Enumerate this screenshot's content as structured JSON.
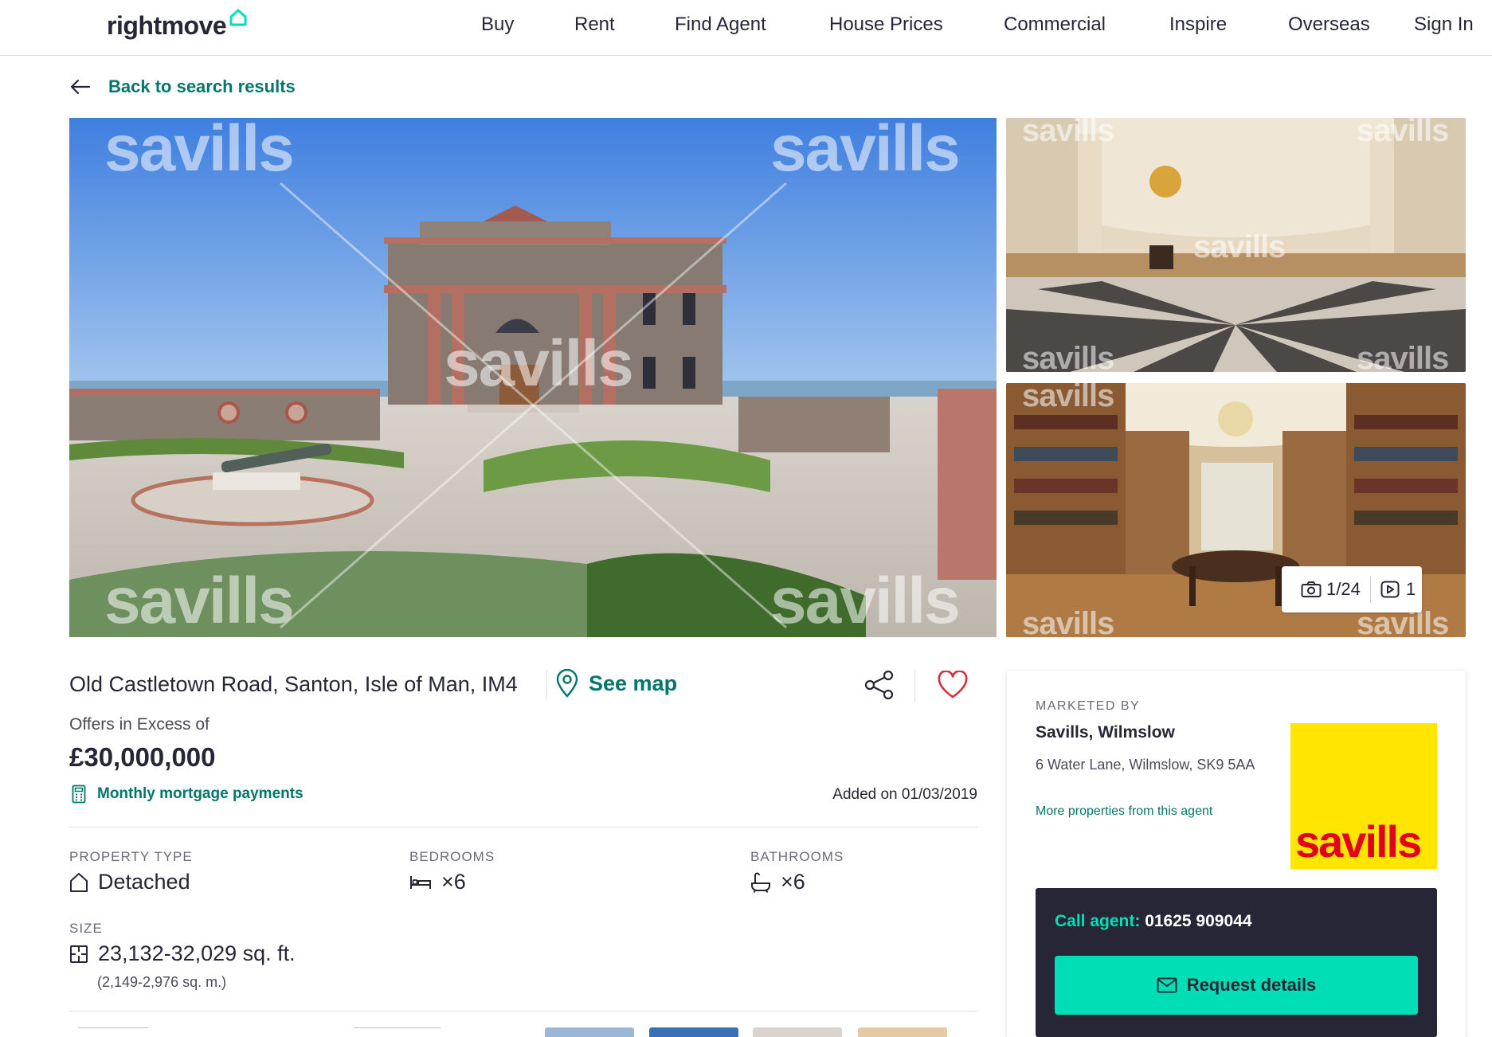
{
  "header": {
    "logo": "rightmove",
    "nav": [
      "Buy",
      "Rent",
      "Find Agent",
      "House Prices",
      "Commercial",
      "Inspire",
      "Overseas"
    ],
    "sign_in": "Sign In"
  },
  "back_link": "Back to search results",
  "gallery": {
    "watermark": "savills",
    "photo_counter": "1/24",
    "video_counter": "1"
  },
  "listing": {
    "address": "Old Castletown Road, Santon, Isle of Man, IM4",
    "see_map": "See map",
    "price_qualifier": "Offers in Excess of",
    "price": "£30,000,000",
    "mortgage_link": "Monthly mortgage payments",
    "added": "Added on 01/03/2019"
  },
  "key_features": {
    "property_type_label": "PROPERTY TYPE",
    "property_type": "Detached",
    "bedrooms_label": "BEDROOMS",
    "bedrooms": "×6",
    "bathrooms_label": "BATHROOMS",
    "bathrooms": "×6",
    "size_label": "SIZE",
    "size": "23,132-32,029 sq. ft.",
    "size_metric": "(2,149-2,976 sq. m.)"
  },
  "agent": {
    "marketed_by": "MARKETED BY",
    "name": "Savills, Wilmslow",
    "address": "6 Water Lane, Wilmslow, SK9 5AA",
    "more_link": "More properties from this agent",
    "logo_text": "savills",
    "call_label": "Call agent:",
    "phone": "01625 909044",
    "request_button": "Request details"
  },
  "colors": {
    "brand_teal": "#00776a",
    "cta_green": "#00deb6",
    "dark_navy": "#262637",
    "savills_yellow": "#ffe500",
    "savills_red": "#e2001a",
    "heart_red": "#d32f3c"
  }
}
